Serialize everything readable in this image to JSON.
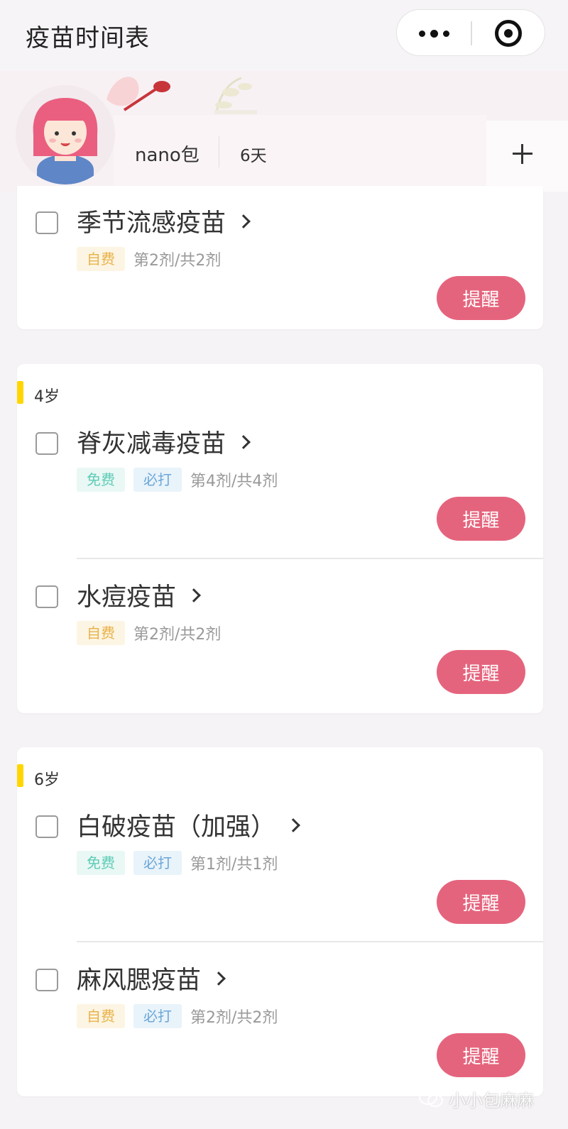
{
  "navbar": {
    "title": "疫苗时间表",
    "more_icon": "ellipsis-icon",
    "target_icon": "target-icon"
  },
  "profile": {
    "name": "nano包",
    "age": "6天",
    "add_icon": "plus-icon"
  },
  "colors": {
    "accent": "#e5647d",
    "age_marker": "#ffd600",
    "tag_self_paid": "#e8b24a",
    "tag_free": "#5fcbb6",
    "tag_required": "#6ba7d8"
  },
  "remind_label": "提醒",
  "groups": [
    {
      "age": "",
      "items": [
        {
          "name": "季节流感疫苗",
          "tags": [
            "自费"
          ],
          "dose": "第2剂/共2剂"
        }
      ]
    },
    {
      "age": "4岁",
      "items": [
        {
          "name": "脊灰减毒疫苗",
          "tags": [
            "免费",
            "必打"
          ],
          "dose": "第4剂/共4剂"
        },
        {
          "name": "水痘疫苗",
          "tags": [
            "自费"
          ],
          "dose": "第2剂/共2剂"
        }
      ]
    },
    {
      "age": "6岁",
      "items": [
        {
          "name": "白破疫苗（加强）",
          "tags": [
            "免费",
            "必打"
          ],
          "dose": "第1剂/共1剂"
        },
        {
          "name": "麻风腮疫苗",
          "tags": [
            "自费",
            "必打"
          ],
          "dose": "第2剂/共2剂"
        }
      ]
    }
  ],
  "watermark": "小小包麻麻"
}
